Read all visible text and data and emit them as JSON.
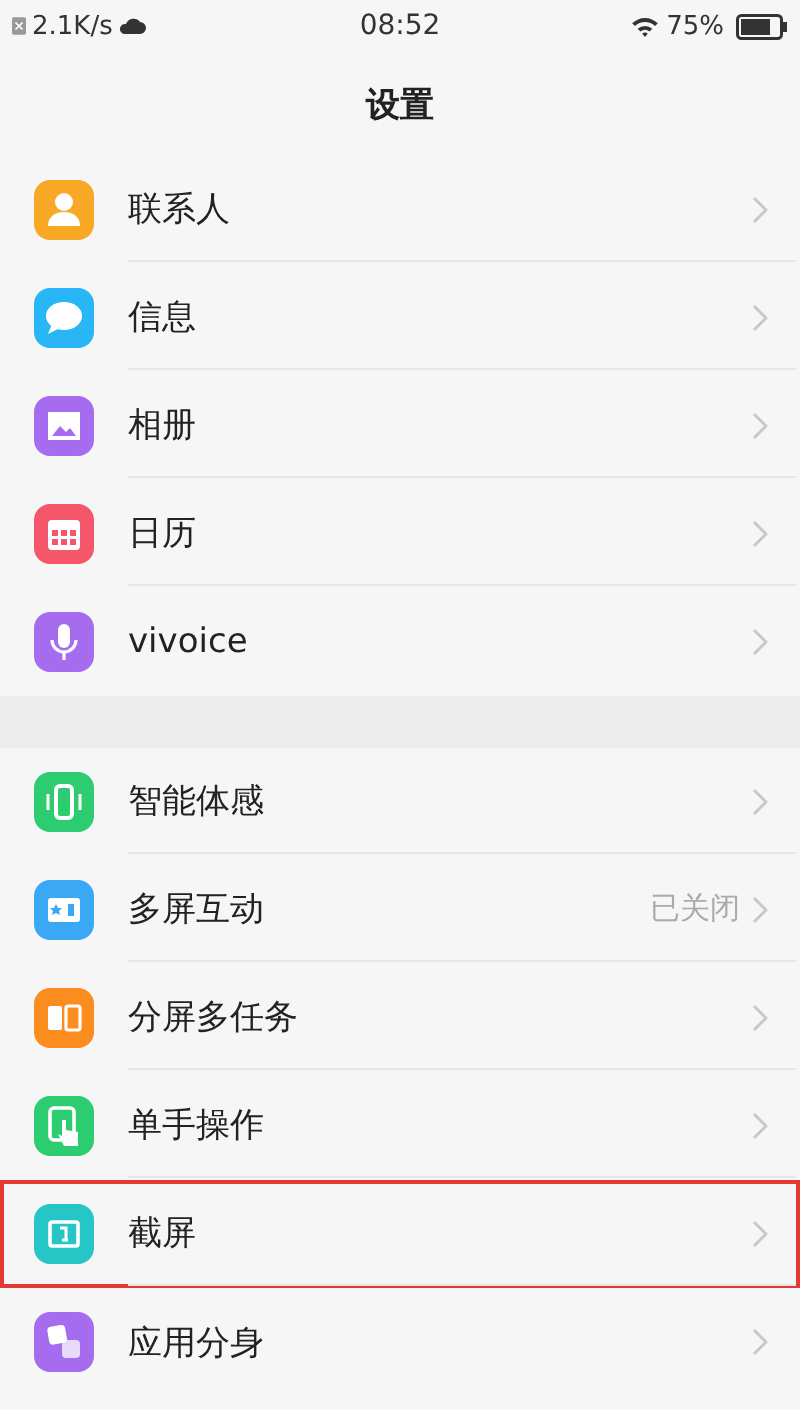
{
  "status_bar": {
    "speed": "2.1K/s",
    "time": "08:52",
    "battery": "75%"
  },
  "title": "设置",
  "groups": [
    {
      "items": [
        {
          "label": "联系人",
          "kind": "person",
          "color": "#f9a825",
          "highlighted": false
        },
        {
          "label": "信息",
          "kind": "bubble",
          "color": "#29b6f6",
          "highlighted": false
        },
        {
          "label": "相册",
          "kind": "image",
          "color": "#a56cf0",
          "highlighted": false
        },
        {
          "label": "日历",
          "kind": "calendar",
          "color": "#f5566a",
          "highlighted": false
        },
        {
          "label": "vivoice",
          "kind": "mic",
          "color": "#a56cf0",
          "highlighted": false
        }
      ]
    },
    {
      "items": [
        {
          "label": "智能体感",
          "kind": "phone",
          "color": "#2ecc71",
          "highlighted": false
        },
        {
          "label": "多屏互动",
          "kind": "screen",
          "color": "#3aa8f5",
          "value": "已关闭",
          "highlighted": false
        },
        {
          "label": "分屏多任务",
          "kind": "split",
          "color": "#fb8c1e",
          "highlighted": false
        },
        {
          "label": "单手操作",
          "kind": "hand",
          "color": "#2ecc71",
          "highlighted": false
        },
        {
          "label": "截屏",
          "kind": "shot",
          "color": "#26c6c6",
          "highlighted": true
        },
        {
          "label": "应用分身",
          "kind": "clone",
          "color": "#a56cf0",
          "highlighted": false
        }
      ]
    }
  ]
}
